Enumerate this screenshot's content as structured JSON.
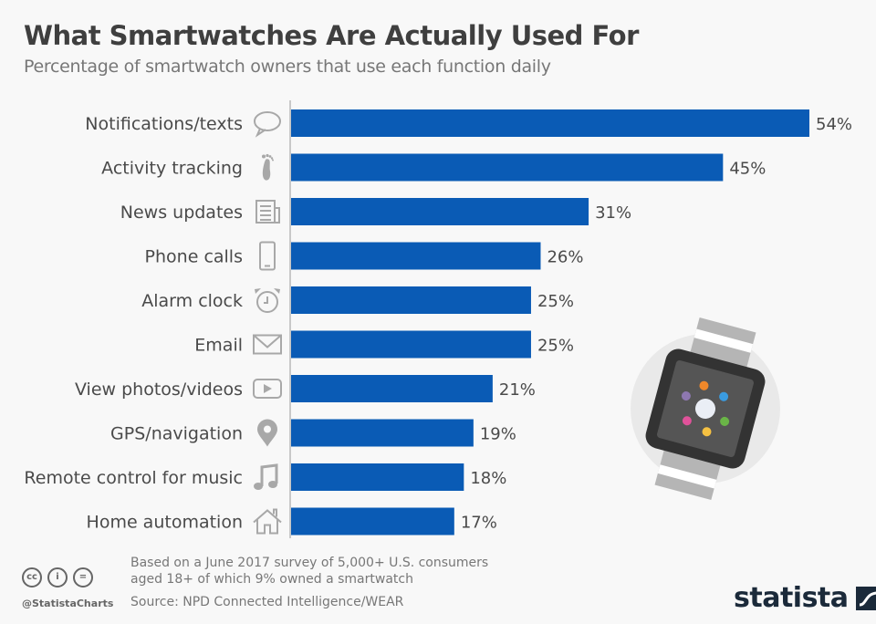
{
  "header": {
    "title": "What Smartwatches Are Actually Used For",
    "subtitle": "Percentage of smartwatch owners that use each function daily"
  },
  "chart_data": {
    "type": "bar",
    "orientation": "horizontal",
    "title": "What Smartwatches Are Actually Used For",
    "subtitle": "Percentage of smartwatch owners that use each function daily",
    "xlabel": "",
    "ylabel": "",
    "unit": "%",
    "xlim": [
      0,
      54
    ],
    "grid": false,
    "bar_color": "#0a5bb5",
    "categories": [
      "Notifications/texts",
      "Activity tracking",
      "News updates",
      "Phone calls",
      "Alarm clock",
      "Email",
      "View photos/videos",
      "GPS/navigation",
      "Remote control for music",
      "Home automation"
    ],
    "icons": [
      "speech-bubble-icon",
      "footprint-icon",
      "newspaper-icon",
      "smartphone-icon",
      "alarm-clock-icon",
      "envelope-icon",
      "play-video-icon",
      "map-pin-icon",
      "music-note-icon",
      "house-icon"
    ],
    "values": [
      54,
      45,
      31,
      26,
      25,
      25,
      21,
      19,
      18,
      17
    ],
    "data_labels": [
      "54%",
      "45%",
      "31%",
      "26%",
      "25%",
      "25%",
      "21%",
      "19%",
      "18%",
      "17%"
    ]
  },
  "footer": {
    "note_line1": "Based on a June 2017 survey of 5,000+ U.S. consumers",
    "note_line2": "aged 18+ of which 9% owned a smartwatch",
    "source": "Source: NPD Connected Intelligence/WEAR",
    "handle": "@StatistaCharts",
    "license_icons": [
      "cc-icon",
      "by-icon",
      "nd-icon"
    ],
    "license_labels": [
      "cc",
      "i",
      "="
    ],
    "logo": "statista"
  }
}
